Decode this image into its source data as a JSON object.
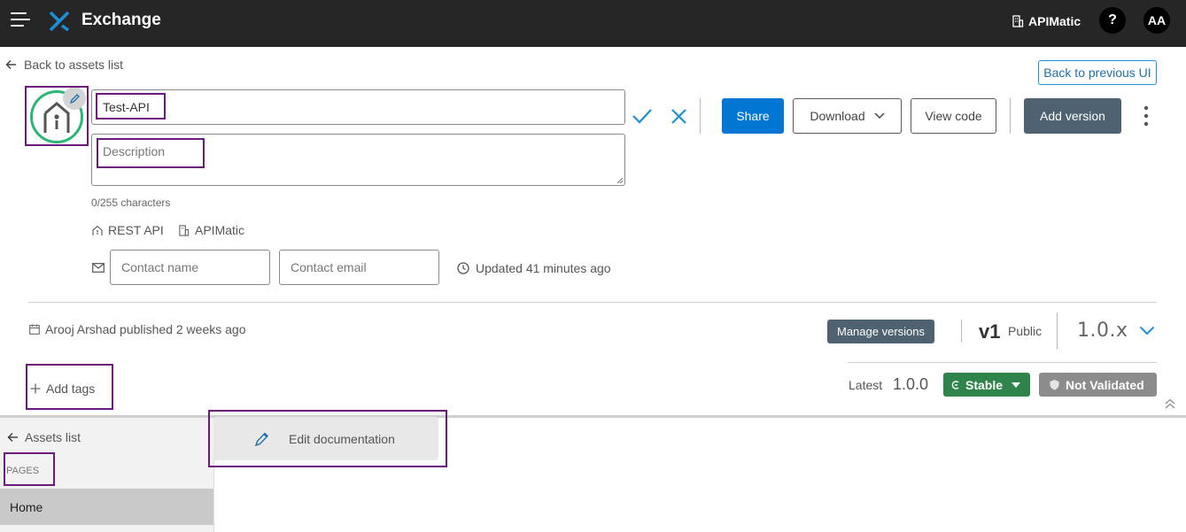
{
  "topbar": {
    "brand": "Exchange",
    "org": "APIMatic",
    "help": "?",
    "avatar": "AA"
  },
  "asset": {
    "back_label": "Back to assets list",
    "back_previous_label": "Back to previous UI",
    "name_value": "Test-API",
    "description_placeholder": "Description",
    "char_count": "0/255 characters",
    "type": "REST API",
    "org": "APIMatic",
    "contact_name_placeholder": "Contact name",
    "contact_email_placeholder": "Contact email",
    "updated": "Updated 41 minutes ago",
    "published": "Arooj Arshad published 2 weeks ago",
    "add_tags": "Add tags"
  },
  "actions": {
    "share": "Share",
    "download": "Download",
    "view_code": "View code",
    "add_version": "Add version",
    "manage_versions": "Manage versions"
  },
  "version": {
    "major": "v1",
    "visibility": "Public",
    "selected": "1.0.x",
    "latest_label": "Latest",
    "latest_value": "1.0.0",
    "stability": "Stable",
    "validation": "Not Validated"
  },
  "docs": {
    "assets_list": "Assets list",
    "pages_heading": "PAGES",
    "pages": [
      "Home"
    ],
    "edit_documentation": "Edit documentation"
  },
  "colors": {
    "topbar": "#262626",
    "primary": "#0176d3",
    "accent": "#1d8fd7",
    "stable": "#2e844a",
    "not_validated": "#8c8c8c",
    "highlight": "#6d1a7e",
    "icon_ring": "#2bb673"
  }
}
